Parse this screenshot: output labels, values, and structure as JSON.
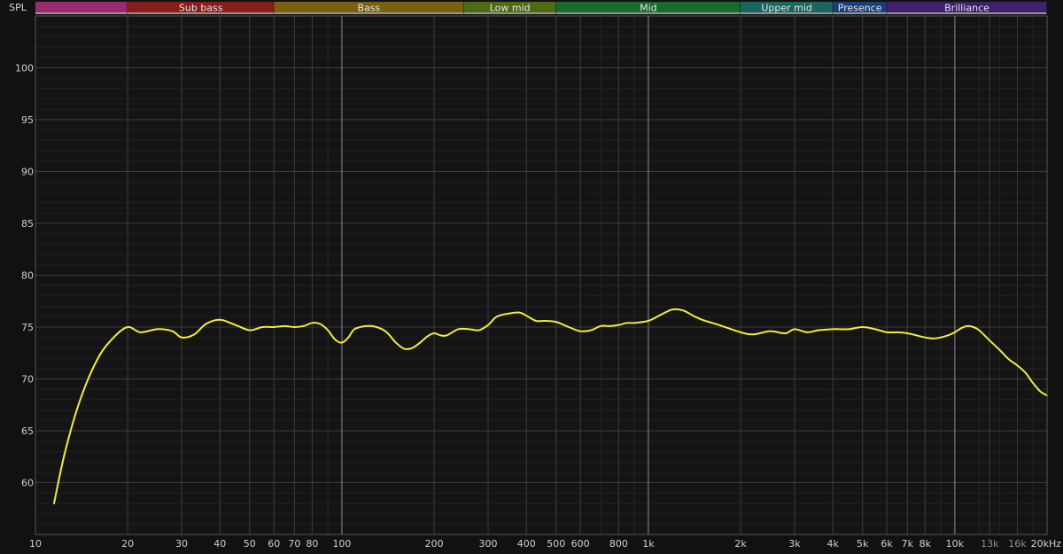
{
  "chart_data": {
    "type": "line",
    "ylabel": "SPL",
    "x_scale": "log",
    "xlim": [
      10,
      20000
    ],
    "ylim": [
      55,
      105
    ],
    "grid": true,
    "y_ticks": [
      60,
      65,
      70,
      75,
      80,
      85,
      90,
      95,
      100
    ],
    "x_ticks": [
      {
        "value": 10,
        "label": "10"
      },
      {
        "value": 20,
        "label": "20"
      },
      {
        "value": 30,
        "label": "30"
      },
      {
        "value": 40,
        "label": "40"
      },
      {
        "value": 50,
        "label": "50"
      },
      {
        "value": 60,
        "label": "60"
      },
      {
        "value": 70,
        "label": "70"
      },
      {
        "value": 80,
        "label": "80"
      },
      {
        "value": 100,
        "label": "100"
      },
      {
        "value": 200,
        "label": "200"
      },
      {
        "value": 300,
        "label": "300"
      },
      {
        "value": 400,
        "label": "400"
      },
      {
        "value": 500,
        "label": "500"
      },
      {
        "value": 600,
        "label": "600"
      },
      {
        "value": 800,
        "label": "800"
      },
      {
        "value": 1000,
        "label": "1k"
      },
      {
        "value": 2000,
        "label": "2k"
      },
      {
        "value": 3000,
        "label": "3k"
      },
      {
        "value": 4000,
        "label": "4k"
      },
      {
        "value": 5000,
        "label": "5k"
      },
      {
        "value": 6000,
        "label": "6k"
      },
      {
        "value": 7000,
        "label": "7k"
      },
      {
        "value": 8000,
        "label": "8k"
      },
      {
        "value": 10000,
        "label": "10k"
      },
      {
        "value": 13000,
        "label": "13k"
      },
      {
        "value": 16000,
        "label": "16k"
      },
      {
        "value": 20000,
        "label": "20kHz"
      }
    ],
    "bands": [
      {
        "label": "",
        "from": 10,
        "to": 20,
        "color": "#9a2a70"
      },
      {
        "label": "Sub bass",
        "from": 20,
        "to": 60,
        "color": "#8a1c1c"
      },
      {
        "label": "Bass",
        "from": 60,
        "to": 250,
        "color": "#7a6010"
      },
      {
        "label": "Low mid",
        "from": 250,
        "to": 500,
        "color": "#4e6a14"
      },
      {
        "label": "Mid",
        "from": 500,
        "to": 2000,
        "color": "#186b2a"
      },
      {
        "label": "Upper mid",
        "from": 2000,
        "to": 4000,
        "color": "#1a6660"
      },
      {
        "label": "Presence",
        "from": 4000,
        "to": 6000,
        "color": "#1a3f78"
      },
      {
        "label": "Brilliance",
        "from": 6000,
        "to": 20000,
        "color": "#3f1f6e"
      }
    ],
    "series": [
      {
        "color": "#f2ee32",
        "x": [
          11.5,
          12.5,
          14,
          16,
          18,
          20,
          22,
          25,
          28,
          30,
          33,
          36,
          40,
          45,
          50,
          55,
          60,
          65,
          70,
          75,
          80,
          85,
          90,
          95,
          100,
          105,
          110,
          120,
          130,
          140,
          150,
          160,
          170,
          180,
          190,
          200,
          210,
          220,
          240,
          260,
          280,
          300,
          320,
          350,
          380,
          400,
          430,
          460,
          500,
          550,
          600,
          650,
          700,
          750,
          800,
          850,
          900,
          1000,
          1100,
          1200,
          1300,
          1400,
          1500,
          1700,
          2000,
          2200,
          2500,
          2800,
          3000,
          3300,
          3600,
          4000,
          4500,
          5000,
          5500,
          6000,
          6500,
          7000,
          7500,
          8000,
          8500,
          9000,
          9500,
          10000,
          10500,
          11000,
          11500,
          12000,
          13000,
          14000,
          15000,
          16000,
          17000,
          18000,
          19000,
          20000
        ],
        "y": [
          58,
          63,
          68,
          72,
          74,
          75,
          74.5,
          74.8,
          74.6,
          74,
          74.3,
          75.3,
          75.7,
          75.2,
          74.7,
          75,
          75,
          75.1,
          75,
          75.1,
          75.4,
          75.3,
          74.7,
          73.8,
          73.5,
          74,
          74.8,
          75.1,
          75,
          74.5,
          73.5,
          72.9,
          73,
          73.5,
          74.1,
          74.4,
          74.2,
          74.2,
          74.8,
          74.8,
          74.7,
          75.2,
          76,
          76.3,
          76.4,
          76.1,
          75.6,
          75.6,
          75.5,
          75,
          74.6,
          74.7,
          75.1,
          75.1,
          75.2,
          75.4,
          75.4,
          75.6,
          76.2,
          76.7,
          76.6,
          76.1,
          75.7,
          75.2,
          74.5,
          74.3,
          74.6,
          74.4,
          74.8,
          74.5,
          74.7,
          74.8,
          74.8,
          75.0,
          74.8,
          74.5,
          74.5,
          74.4,
          74.2,
          74.0,
          73.9,
          74.0,
          74.2,
          74.5,
          74.9,
          75.1,
          75.0,
          74.7,
          73.7,
          72.8,
          71.9,
          71.3,
          70.6,
          69.6,
          68.8,
          68.4
        ]
      }
    ]
  }
}
